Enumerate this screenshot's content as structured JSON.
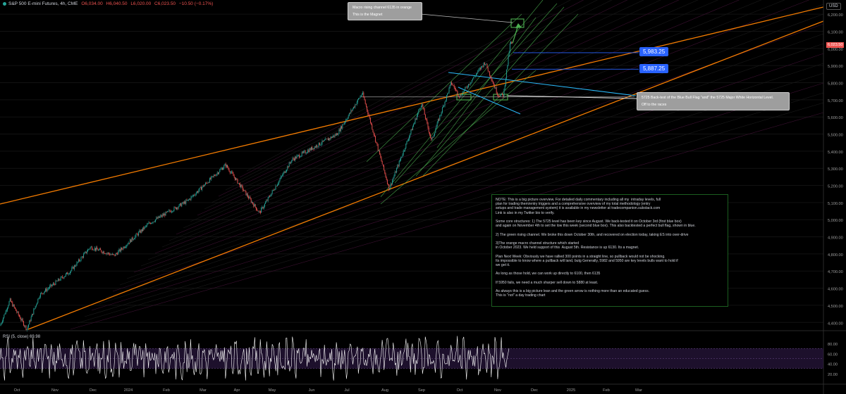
{
  "header": {
    "symbol": "S&P 500 E-mini Futures, 4h, CME",
    "open": "O6,034.00",
    "high": "H6,040.50",
    "low": "L6,020.00",
    "close": "C6,023.50",
    "change": "−10.50 (−0.17%)"
  },
  "currency_label": "USD",
  "last_price_tag": "6,023.50",
  "callouts": {
    "magnet_line1": "Macro rising channel 6135 in orange",
    "magnet_line2": "This is the Magnet",
    "retest_line1": "5725 Back-test of the Blue Bull Flag \"and\" the 5725 Major White Horizontal Level.",
    "retest_line2": "Off to the races"
  },
  "levels": {
    "level1": "5,983.25",
    "level2": "5,887.25"
  },
  "note_text": "NOTE: This is a big picture overview. For detailed daily commentary including all my  intraday levels, full\nplan for trading them/entry triggers and a comprehensive overview of my total methodology (entry\nsetups and trade management system) it is available in my newsletter at tradecompanion.substack.com\nLink is also in my Twitter bio to verify.\n\nSome core structures: 1) The 5725 level has been key since August. We back-tested it on October 3rd (first blue box)\nand again on November 4th to set the low this week (second blue box). This also backtested a perfect bull flag, shown in blue.\n\n2) The green rising channel. We broke this down October 30th, and recovered on election today, taking ES into over-drive\n\n3)The orange macro channel structure which started\nin October 2023. We held support of this  August 5th. Resistance is up 6130. Its a magnet.\n\nPlan Next Week: Obviously we have rallied 300 points in a straight line, so pullback would not be shocking.\nIts impossible to know where a pullback will land, butg Generally, 5982 and 5950 are key levels bulls want to hold if\nwe get it.\n\nAs long as those hold, we can work up directly to 6100, then 6135\n\nIf 5950 fails, we need a much sharper sell down to 5880 at least.\n\nAs always this is a big picture lean and the green arrow is nothing more than an educated guess.\nThis is \"not\" a day trading chart",
  "rsi_label": "RSI (5, close)",
  "rsi_value": "69.98",
  "colors": {
    "background": "#000000",
    "orange_channel": "#f57c00",
    "green_channel": "#4caf50",
    "blue_flag": "#29b6f6",
    "candle_up": "#26a69a",
    "candle_down": "#ef5350",
    "rsi_line": "#ffffff",
    "rsi_band": "#311b4a"
  },
  "chart_data": {
    "type": "candlestick",
    "title": "S&P 500 E-mini Futures, 4h, CME",
    "x_tick_labels": [
      "Oct",
      "Nov",
      "Dec",
      "2024",
      "Feb",
      "Mar",
      "Apr",
      "May",
      "Jun",
      "Jul",
      "Aug",
      "Sep",
      "Oct",
      "Nov",
      "Dec",
      "2025",
      "Feb",
      "Mar"
    ],
    "y_tick_labels": [
      "6,200.00",
      "6,100.00",
      "6,000.00",
      "5,900.00",
      "5,800.00",
      "5,700.00",
      "5,600.00",
      "5,500.00",
      "5,400.00",
      "5,300.00",
      "5,200.00",
      "5,100.00",
      "5,000.00",
      "4,900.00",
      "4,800.00",
      "4,700.00",
      "4,600.00",
      "4,500.00",
      "4,400.00"
    ],
    "ylim": [
      4360,
      6250
    ],
    "price_path": [
      {
        "date": "2023-09-28",
        "price": 4380
      },
      {
        "date": "2023-10-10",
        "price": 4530
      },
      {
        "date": "2023-10-27",
        "price": 4360
      },
      {
        "date": "2023-11-10",
        "price": 4560
      },
      {
        "date": "2023-12-01",
        "price": 4700
      },
      {
        "date": "2023-12-18",
        "price": 4840
      },
      {
        "date": "2024-01-05",
        "price": 4790
      },
      {
        "date": "2024-01-31",
        "price": 4980
      },
      {
        "date": "2024-02-28",
        "price": 5110
      },
      {
        "date": "2024-03-28",
        "price": 5320
      },
      {
        "date": "2024-04-19",
        "price": 5040
      },
      {
        "date": "2024-05-15",
        "price": 5350
      },
      {
        "date": "2024-06-14",
        "price": 5500
      },
      {
        "date": "2024-07-16",
        "price": 5740
      },
      {
        "date": "2024-08-05",
        "price": 5180
      },
      {
        "date": "2024-08-30",
        "price": 5680
      },
      {
        "date": "2024-09-06",
        "price": 5460
      },
      {
        "date": "2024-09-27",
        "price": 5800
      },
      {
        "date": "2024-10-03",
        "price": 5720
      },
      {
        "date": "2024-10-18",
        "price": 5920
      },
      {
        "date": "2024-10-31",
        "price": 5730
      },
      {
        "date": "2024-11-04",
        "price": 5725
      },
      {
        "date": "2024-11-08",
        "price": 6040
      },
      {
        "date": "2024-11-10",
        "price": 6023.5
      }
    ],
    "horizontal_levels": [
      5725,
      5983.25,
      5887.25
    ],
    "target": 6135,
    "rsi": {
      "name": "RSI (5, close)",
      "last": 69.98,
      "ylim": [
        0,
        100
      ],
      "ticks": [
        "80.00",
        "60.00",
        "40.00",
        "20.00"
      ],
      "band": [
        30,
        70
      ]
    }
  }
}
